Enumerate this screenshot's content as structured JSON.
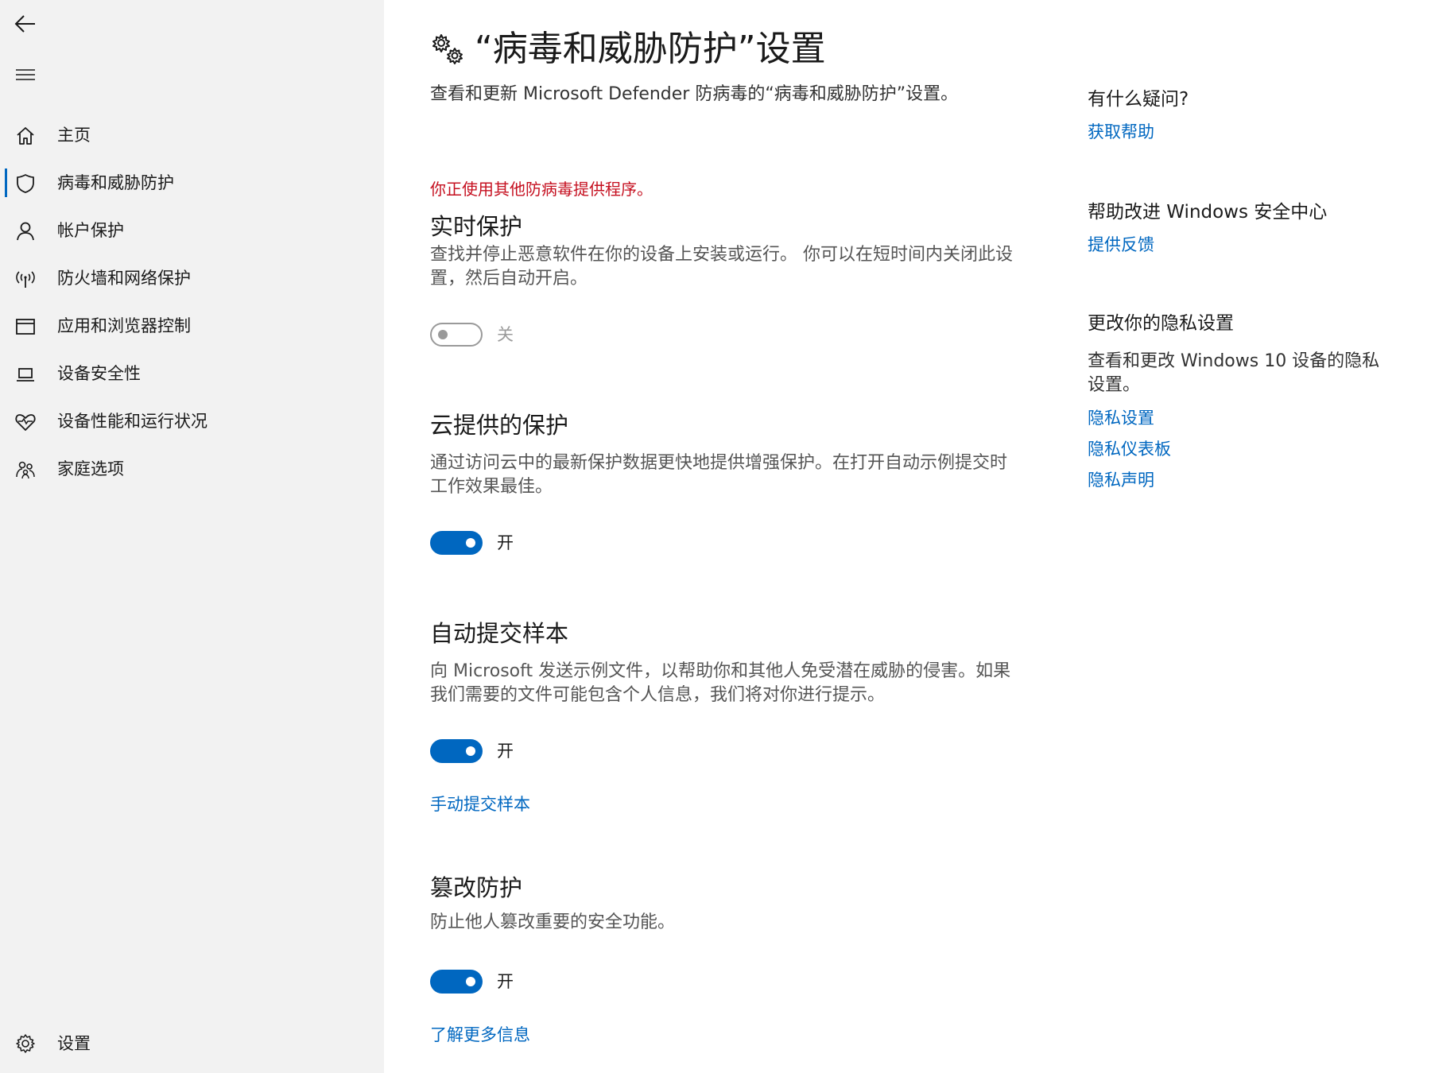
{
  "sidebar": {
    "back_icon": "back-arrow-icon",
    "menu_icon": "hamburger-menu-icon",
    "items": [
      {
        "label": "主页",
        "icon": "home-icon",
        "active": false
      },
      {
        "label": "病毒和威胁防护",
        "icon": "shield-icon",
        "active": true
      },
      {
        "label": "帐户保护",
        "icon": "person-icon",
        "active": false
      },
      {
        "label": "防火墙和网络保护",
        "icon": "wireless-icon",
        "active": false
      },
      {
        "label": "应用和浏览器控制",
        "icon": "browser-window-icon",
        "active": false
      },
      {
        "label": "设备安全性",
        "icon": "laptop-icon",
        "active": false
      },
      {
        "label": "设备性能和运行状况",
        "icon": "heart-pulse-icon",
        "active": false
      },
      {
        "label": "家庭选项",
        "icon": "family-icon",
        "active": false
      }
    ],
    "settings": {
      "label": "设置",
      "icon": "gear-icon"
    }
  },
  "main": {
    "title": "“病毒和威胁防护”设置",
    "title_icon": "gears-icon",
    "subtitle": "查看和更新 Microsoft Defender 防病毒的“病毒和威胁防护”设置。",
    "warning": "你正使用其他防病毒提供程序。",
    "sections": [
      {
        "heading": "实时保护",
        "description": "查找并停止恶意软件在你的设备上安装或运行。 你可以在短时间内关闭此设置，然后自动开启。",
        "toggle_state": "off",
        "toggle_label": "关"
      },
      {
        "heading": "云提供的保护",
        "description": "通过访问云中的最新保护数据更快地提供增强保护。在打开自动示例提交时工作效果最佳。",
        "toggle_state": "on",
        "toggle_label": "开"
      },
      {
        "heading": "自动提交样本",
        "description": "向 Microsoft 发送示例文件，以帮助你和其他人免受潜在威胁的侵害。如果我们需要的文件可能包含个人信息，我们将对你进行提示。",
        "toggle_state": "on",
        "toggle_label": "开",
        "link": "手动提交样本"
      },
      {
        "heading": "篡改防护",
        "description": "防止他人篡改重要的安全功能。",
        "toggle_state": "on",
        "toggle_label": "开",
        "link": "了解更多信息"
      }
    ]
  },
  "aside": {
    "help_heading": "有什么疑问?",
    "help_link": "获取帮助",
    "improve_heading": "帮助改进 Windows 安全中心",
    "improve_link": "提供反馈",
    "privacy_heading": "更改你的隐私设置",
    "privacy_desc": "查看和更改 Windows 10 设备的隐私设置。",
    "privacy_links": [
      "隐私设置",
      "隐私仪表板",
      "隐私声明"
    ]
  },
  "colors": {
    "accent": "#0067c0",
    "warning": "#c50f1f",
    "sidebar_bg": "#f2f2f2"
  }
}
